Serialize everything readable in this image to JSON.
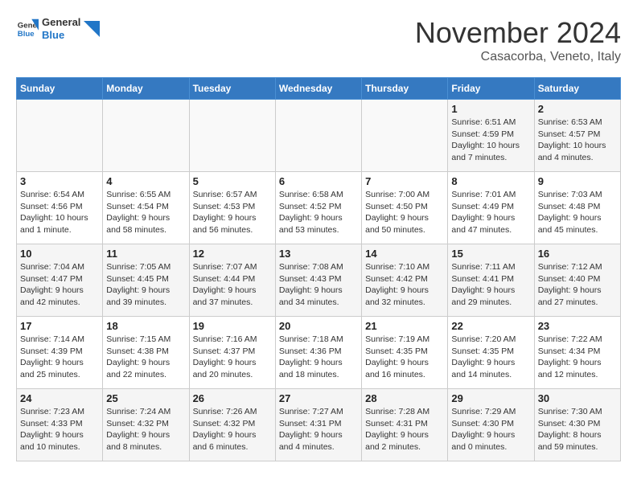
{
  "header": {
    "logo_general": "General",
    "logo_blue": "Blue",
    "month_title": "November 2024",
    "location": "Casacorba, Veneto, Italy"
  },
  "weekdays": [
    "Sunday",
    "Monday",
    "Tuesday",
    "Wednesday",
    "Thursday",
    "Friday",
    "Saturday"
  ],
  "weeks": [
    [
      {
        "day": "",
        "info": ""
      },
      {
        "day": "",
        "info": ""
      },
      {
        "day": "",
        "info": ""
      },
      {
        "day": "",
        "info": ""
      },
      {
        "day": "",
        "info": ""
      },
      {
        "day": "1",
        "info": "Sunrise: 6:51 AM\nSunset: 4:59 PM\nDaylight: 10 hours and 7 minutes."
      },
      {
        "day": "2",
        "info": "Sunrise: 6:53 AM\nSunset: 4:57 PM\nDaylight: 10 hours and 4 minutes."
      }
    ],
    [
      {
        "day": "3",
        "info": "Sunrise: 6:54 AM\nSunset: 4:56 PM\nDaylight: 10 hours and 1 minute."
      },
      {
        "day": "4",
        "info": "Sunrise: 6:55 AM\nSunset: 4:54 PM\nDaylight: 9 hours and 58 minutes."
      },
      {
        "day": "5",
        "info": "Sunrise: 6:57 AM\nSunset: 4:53 PM\nDaylight: 9 hours and 56 minutes."
      },
      {
        "day": "6",
        "info": "Sunrise: 6:58 AM\nSunset: 4:52 PM\nDaylight: 9 hours and 53 minutes."
      },
      {
        "day": "7",
        "info": "Sunrise: 7:00 AM\nSunset: 4:50 PM\nDaylight: 9 hours and 50 minutes."
      },
      {
        "day": "8",
        "info": "Sunrise: 7:01 AM\nSunset: 4:49 PM\nDaylight: 9 hours and 47 minutes."
      },
      {
        "day": "9",
        "info": "Sunrise: 7:03 AM\nSunset: 4:48 PM\nDaylight: 9 hours and 45 minutes."
      }
    ],
    [
      {
        "day": "10",
        "info": "Sunrise: 7:04 AM\nSunset: 4:47 PM\nDaylight: 9 hours and 42 minutes."
      },
      {
        "day": "11",
        "info": "Sunrise: 7:05 AM\nSunset: 4:45 PM\nDaylight: 9 hours and 39 minutes."
      },
      {
        "day": "12",
        "info": "Sunrise: 7:07 AM\nSunset: 4:44 PM\nDaylight: 9 hours and 37 minutes."
      },
      {
        "day": "13",
        "info": "Sunrise: 7:08 AM\nSunset: 4:43 PM\nDaylight: 9 hours and 34 minutes."
      },
      {
        "day": "14",
        "info": "Sunrise: 7:10 AM\nSunset: 4:42 PM\nDaylight: 9 hours and 32 minutes."
      },
      {
        "day": "15",
        "info": "Sunrise: 7:11 AM\nSunset: 4:41 PM\nDaylight: 9 hours and 29 minutes."
      },
      {
        "day": "16",
        "info": "Sunrise: 7:12 AM\nSunset: 4:40 PM\nDaylight: 9 hours and 27 minutes."
      }
    ],
    [
      {
        "day": "17",
        "info": "Sunrise: 7:14 AM\nSunset: 4:39 PM\nDaylight: 9 hours and 25 minutes."
      },
      {
        "day": "18",
        "info": "Sunrise: 7:15 AM\nSunset: 4:38 PM\nDaylight: 9 hours and 22 minutes."
      },
      {
        "day": "19",
        "info": "Sunrise: 7:16 AM\nSunset: 4:37 PM\nDaylight: 9 hours and 20 minutes."
      },
      {
        "day": "20",
        "info": "Sunrise: 7:18 AM\nSunset: 4:36 PM\nDaylight: 9 hours and 18 minutes."
      },
      {
        "day": "21",
        "info": "Sunrise: 7:19 AM\nSunset: 4:35 PM\nDaylight: 9 hours and 16 minutes."
      },
      {
        "day": "22",
        "info": "Sunrise: 7:20 AM\nSunset: 4:35 PM\nDaylight: 9 hours and 14 minutes."
      },
      {
        "day": "23",
        "info": "Sunrise: 7:22 AM\nSunset: 4:34 PM\nDaylight: 9 hours and 12 minutes."
      }
    ],
    [
      {
        "day": "24",
        "info": "Sunrise: 7:23 AM\nSunset: 4:33 PM\nDaylight: 9 hours and 10 minutes."
      },
      {
        "day": "25",
        "info": "Sunrise: 7:24 AM\nSunset: 4:32 PM\nDaylight: 9 hours and 8 minutes."
      },
      {
        "day": "26",
        "info": "Sunrise: 7:26 AM\nSunset: 4:32 PM\nDaylight: 9 hours and 6 minutes."
      },
      {
        "day": "27",
        "info": "Sunrise: 7:27 AM\nSunset: 4:31 PM\nDaylight: 9 hours and 4 minutes."
      },
      {
        "day": "28",
        "info": "Sunrise: 7:28 AM\nSunset: 4:31 PM\nDaylight: 9 hours and 2 minutes."
      },
      {
        "day": "29",
        "info": "Sunrise: 7:29 AM\nSunset: 4:30 PM\nDaylight: 9 hours and 0 minutes."
      },
      {
        "day": "30",
        "info": "Sunrise: 7:30 AM\nSunset: 4:30 PM\nDaylight: 8 hours and 59 minutes."
      }
    ]
  ]
}
